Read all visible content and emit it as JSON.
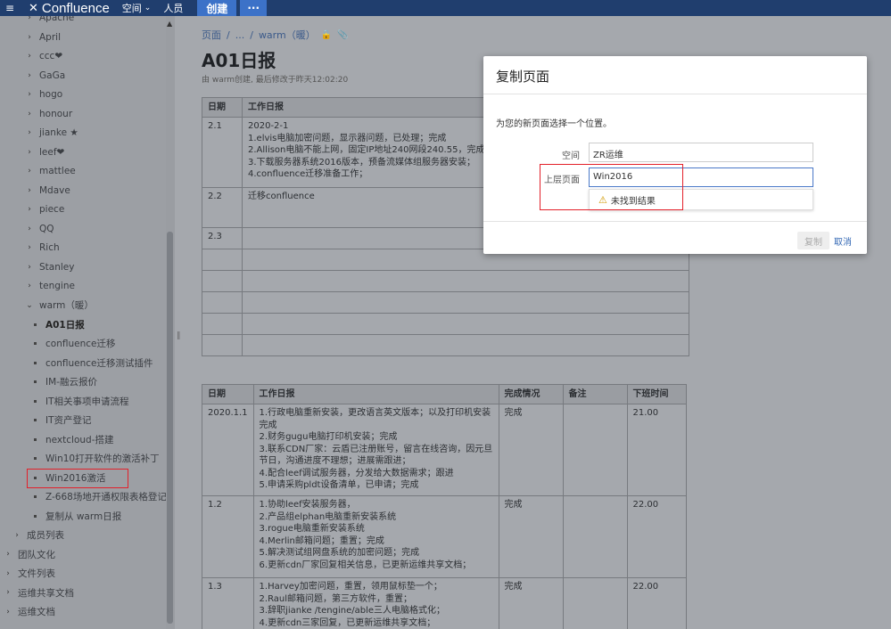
{
  "topbar": {
    "brand": "Confluence",
    "nav_spaces": "空间",
    "nav_people": "人员",
    "create": "创建",
    "more": "···"
  },
  "sidebar": {
    "items": [
      {
        "label": "Apache",
        "type": "collapsed",
        "indent": 0
      },
      {
        "label": "April",
        "type": "collapsed"
      },
      {
        "label": "ccc❤",
        "type": "collapsed"
      },
      {
        "label": "GaGa",
        "type": "collapsed"
      },
      {
        "label": "hogo",
        "type": "collapsed"
      },
      {
        "label": "honour",
        "type": "collapsed"
      },
      {
        "label": "jianke ★",
        "type": "collapsed"
      },
      {
        "label": "leef❤",
        "type": "collapsed"
      },
      {
        "label": "mattlee",
        "type": "collapsed"
      },
      {
        "label": "Mdave",
        "type": "collapsed"
      },
      {
        "label": "piece",
        "type": "collapsed"
      },
      {
        "label": "QQ",
        "type": "collapsed"
      },
      {
        "label": "Rich",
        "type": "collapsed"
      },
      {
        "label": "Stanley",
        "type": "collapsed"
      },
      {
        "label": "tengine",
        "type": "collapsed"
      },
      {
        "label": "warm（暖）",
        "type": "expanded"
      },
      {
        "label": "A01日报",
        "type": "child",
        "current": true
      },
      {
        "label": "confluence迁移",
        "type": "child"
      },
      {
        "label": "confluence迁移测试插件",
        "type": "child"
      },
      {
        "label": "IM-融云报价",
        "type": "child"
      },
      {
        "label": "IT相关事项申请流程",
        "type": "child"
      },
      {
        "label": "IT资产登记",
        "type": "child"
      },
      {
        "label": "nextcloud-搭建",
        "type": "child"
      },
      {
        "label": "Win10打开软件的激活补丁",
        "type": "child"
      },
      {
        "label": "Win2016激活",
        "type": "child"
      },
      {
        "label": "Z-668场地开通权限表格登记",
        "type": "child"
      },
      {
        "label": "复制从 warm日报",
        "type": "child"
      },
      {
        "label": "成员列表",
        "type": "section"
      },
      {
        "label": "团队文化",
        "type": "top"
      },
      {
        "label": "文件列表",
        "type": "top"
      },
      {
        "label": "运维共享文档",
        "type": "top"
      },
      {
        "label": "运维文档",
        "type": "top"
      }
    ]
  },
  "page": {
    "breadcrumb_root": "页面",
    "breadcrumb_sep": "/",
    "breadcrumb_ellipsis": "...",
    "breadcrumb_parent": "warm（暖）",
    "title": "A01日报",
    "meta": "由 warm创建, 最后修改于昨天12:02:20"
  },
  "table1": {
    "headers": [
      "日期",
      "工作日报"
    ],
    "rows": [
      {
        "date": "2.1",
        "text": [
          "2020-2-1",
          "1.elvis电脑加密问题，显示器问题，已处理；完成",
          "2.Allison电脑不能上网，固定IP地址240网段240.55，完成",
          "3.下载服务器系统2016版本，预备流媒体组服务器安装；",
          "4.confluence迁移准备工作；"
        ]
      },
      {
        "date": "2.2",
        "text": [
          "迁移confluence"
        ]
      },
      {
        "date": "2.3",
        "text": []
      }
    ]
  },
  "table2": {
    "headers": [
      "日期",
      "工作日报",
      "完成情况",
      "备注",
      "下班时间"
    ],
    "rows": [
      {
        "date": "2020.1.1",
        "text": [
          "1.行政电脑重新安装，更改语言英文版本；以及打印机安装完成",
          "2.财务gugu电脑打印机安装；完成",
          "3.联系CDN厂家：云盾已注册账号，留言在线咨询，因元旦节日，沟通进度不理想；进展需跟进；",
          "4.配合leef调试服务器，分发给大数据需求；跟进",
          "5.申请采购pldt设备清单，已申请；完成"
        ],
        "status": "完成",
        "note": "",
        "off": "21.00"
      },
      {
        "date": "1.2",
        "text": [
          "1.协助leef安装服务器，",
          "2.产品组elphan电脑重新安装系统",
          "3.rogue电脑重新安装系统",
          "4.Merlin邮箱问题；重置；完成",
          "5.解决测试组网盘系统的加密问题；完成",
          "6.更新cdn厂家回复相关信息，已更新运维共享文档；"
        ],
        "status": "完成",
        "note": "",
        "off": "22.00"
      },
      {
        "date": "1.3",
        "text": [
          "1.Harvey加密问题，重置，领用鼠标垫一个；",
          "2.Raul邮箱问题，第三方软件，重置；",
          "3.辞职jianke /tengine/able三人电脑格式化；",
          "4.更新cdn三家回复，已更新运维共享文档；"
        ],
        "status": "完成",
        "note": "",
        "off": "22.00"
      }
    ]
  },
  "modal": {
    "title": "复制页面",
    "description": "为您的新页面选择一个位置。",
    "space_label": "空间",
    "space_value": "ZR运维",
    "parent_label": "上层页面",
    "parent_value": "Win2016",
    "no_results": "未找到结果",
    "copy_button": "复制",
    "cancel_button": "取消"
  }
}
